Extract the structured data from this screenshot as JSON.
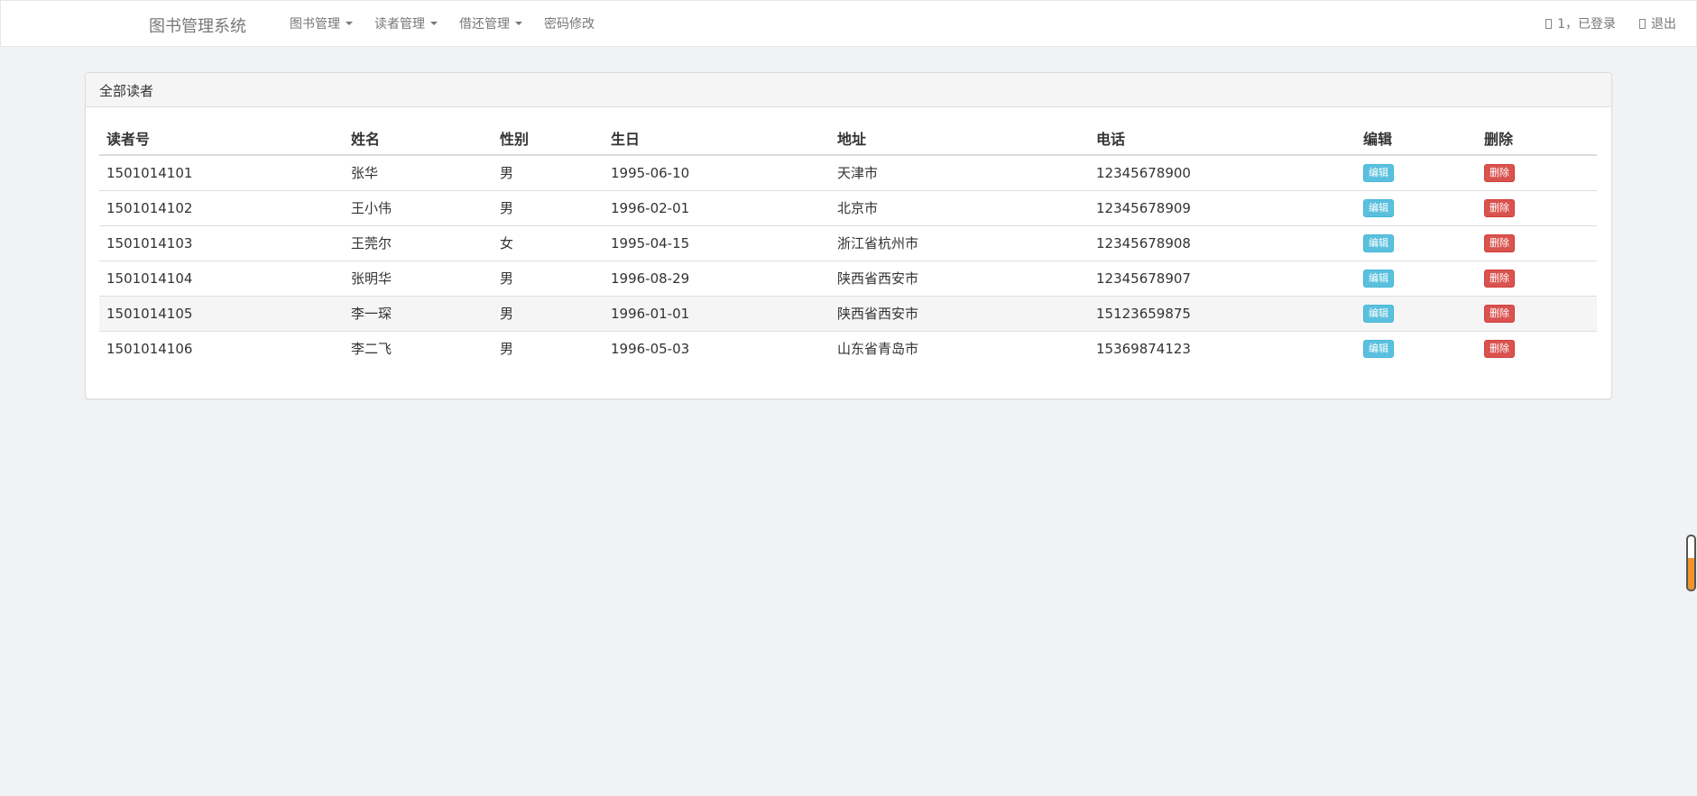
{
  "navbar": {
    "brand": "图书管理系统",
    "menu": [
      {
        "label": "图书管理",
        "dropdown": true
      },
      {
        "label": "读者管理",
        "dropdown": true
      },
      {
        "label": "借还管理",
        "dropdown": true
      },
      {
        "label": "密码修改",
        "dropdown": false
      }
    ],
    "user_status": "1，已登录",
    "logout": "退出"
  },
  "panel": {
    "title": "全部读者",
    "columns": [
      "读者号",
      "姓名",
      "性别",
      "生日",
      "地址",
      "电话",
      "编辑",
      "删除"
    ],
    "edit_label": "编辑",
    "delete_label": "删除",
    "rows": [
      {
        "id": "1501014101",
        "name": "张华",
        "gender": "男",
        "birthday": "1995-06-10",
        "address": "天津市",
        "phone": "12345678900"
      },
      {
        "id": "1501014102",
        "name": "王小伟",
        "gender": "男",
        "birthday": "1996-02-01",
        "address": "北京市",
        "phone": "12345678909"
      },
      {
        "id": "1501014103",
        "name": "王莞尔",
        "gender": "女",
        "birthday": "1995-04-15",
        "address": "浙江省杭州市",
        "phone": "12345678908"
      },
      {
        "id": "1501014104",
        "name": "张明华",
        "gender": "男",
        "birthday": "1996-08-29",
        "address": "陕西省西安市",
        "phone": "12345678907"
      },
      {
        "id": "1501014105",
        "name": "李一琛",
        "gender": "男",
        "birthday": "1996-01-01",
        "address": "陕西省西安市",
        "phone": "15123659875"
      },
      {
        "id": "1501014106",
        "name": "李二飞",
        "gender": "男",
        "birthday": "1996-05-03",
        "address": "山东省青岛市",
        "phone": "15369874123"
      }
    ]
  },
  "scroll_indicator": {
    "level": 0.6,
    "color": "#f0932b"
  },
  "colors": {
    "edit_button": "#5bc0de",
    "delete_button": "#d9534f"
  }
}
